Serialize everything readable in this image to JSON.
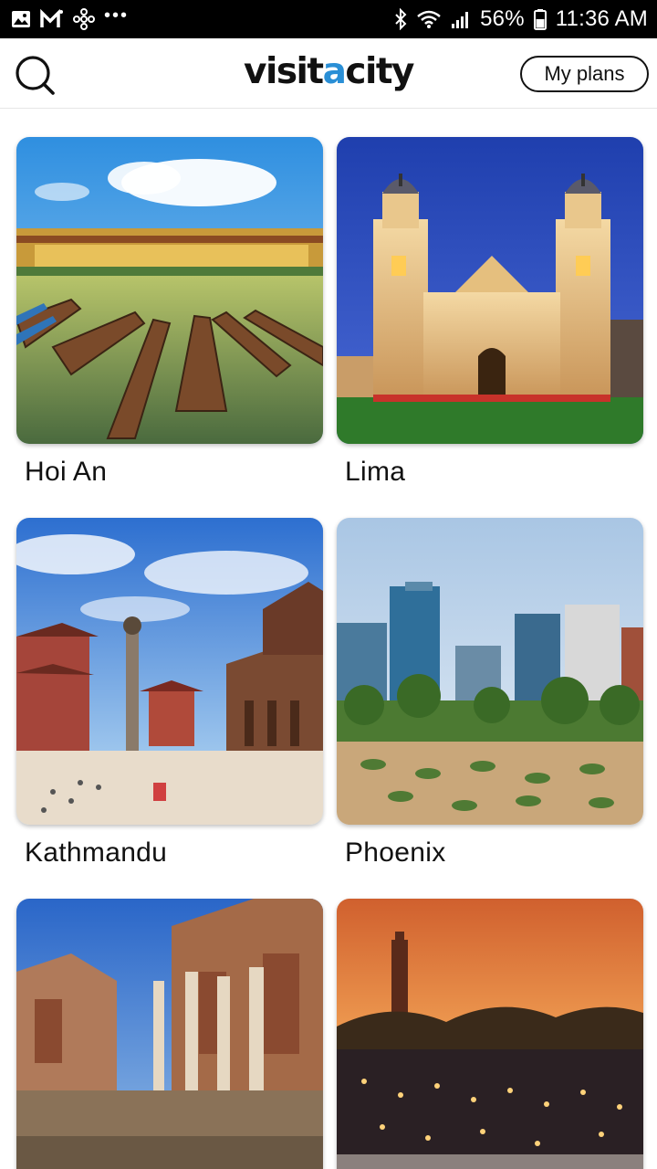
{
  "status_bar": {
    "battery": "56%",
    "time": "11:36 AM",
    "dots": "•••",
    "icons": [
      "gallery-icon",
      "gmail-icon",
      "pinwheel-icon",
      "bluetooth-icon",
      "wifi-icon",
      "signal-icon",
      "battery-icon"
    ]
  },
  "header": {
    "logo_prefix": "visit",
    "logo_accent": "a",
    "logo_suffix": "city",
    "my_plans_label": "My plans",
    "search_icon": "search-icon",
    "accent_color": "#2a8fd6"
  },
  "cities": [
    {
      "name": "Hoi An"
    },
    {
      "name": "Lima"
    },
    {
      "name": "Kathmandu"
    },
    {
      "name": "Phoenix"
    },
    {
      "name": ""
    },
    {
      "name": ""
    }
  ]
}
